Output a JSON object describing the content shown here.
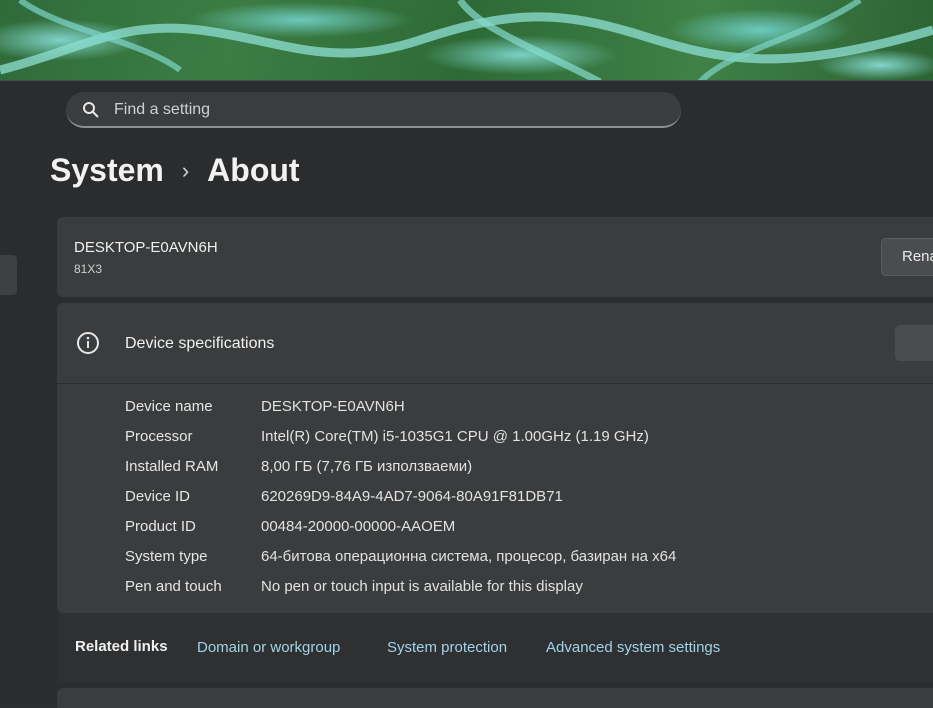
{
  "search": {
    "placeholder": "Find a setting",
    "icon": "search-icon"
  },
  "breadcrumb": {
    "parent": "System",
    "separator": "›",
    "current": "About"
  },
  "device_card": {
    "pc_name": "DESKTOP-E0AVN6H",
    "model": "81X3",
    "rename_label": "Rena"
  },
  "specs": {
    "title": "Device specifications",
    "icon": "info-icon",
    "rows": [
      {
        "key": "Device name",
        "value": "DESKTOP-E0AVN6H"
      },
      {
        "key": "Processor",
        "value": "Intel(R) Core(TM) i5-1035G1 CPU @ 1.00GHz (1.19 GHz)"
      },
      {
        "key": "Installed RAM",
        "value": "8,00 ГБ (7,76 ГБ използваеми)"
      },
      {
        "key": "Device ID",
        "value": "620269D9-84A9-4AD7-9064-80A91F81DB71"
      },
      {
        "key": "Product ID",
        "value": "00484-20000-00000-AAOEM"
      },
      {
        "key": "System type",
        "value": "64-битова операционна система, процесор, базиран на x64"
      },
      {
        "key": "Pen and touch",
        "value": "No pen or touch input is available for this display"
      }
    ]
  },
  "related": {
    "label": "Related links",
    "links": [
      "Domain or workgroup",
      "System protection",
      "Advanced system settings"
    ]
  },
  "colors": {
    "accent_link": "#9fd4ea",
    "card_bg": "#3a3c3d",
    "window_bg": "#2a2c2d"
  }
}
